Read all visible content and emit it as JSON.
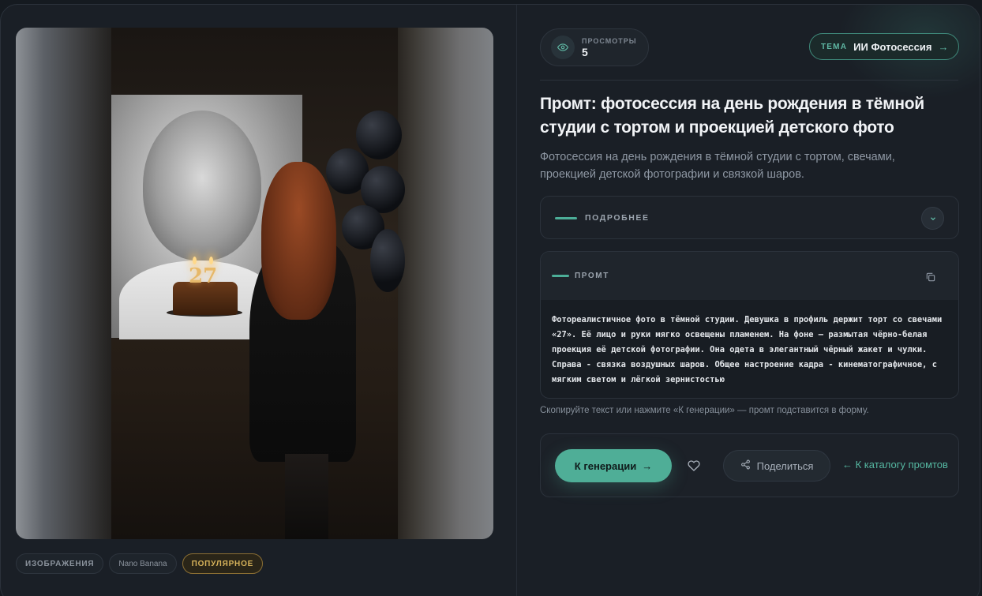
{
  "tags": {
    "category": "ИЗОБРАЖЕНИЯ",
    "model": "Nano Banana",
    "popular": "ПОПУЛЯРНОЕ"
  },
  "views": {
    "label": "ПРОСМОТРЫ",
    "count": "5",
    "icon": "eye-icon"
  },
  "theme": {
    "label": "ТЕМА",
    "value": "ИИ Фотосессия",
    "arrow": "→"
  },
  "title": "Промт: фотосессия на день рождения в тёмной студии с тортом и проекцией детского фото",
  "subtitle": "Фотосессия на день рождения в тёмной студии с тортом, свечами, проекцией детской фотографии и связкой шаров.",
  "details": {
    "label": "ПОДРОБНЕЕ",
    "icon": "chevron-down-icon"
  },
  "prompt": {
    "label": "ПРОМТ",
    "copy_icon": "copy-icon",
    "text": "Фотореалистичное фото в тёмной студии. Девушка в профиль держит торт со свечами «27». Её лицо и руки мягко освещены пламенем. На фоне — размытая чёрно-белая проекция её детской фотографии. Она одета в элегантный чёрный жакет и чулки. Справа - связка воздушных шаров. Общее настроение кадра - кинематографичное, с мягким светом и лёгкой зернистостью"
  },
  "hint": "Скопируйте текст или нажмите «К генерации» — промт подставится в форму.",
  "actions": {
    "generate": "К генерации",
    "generate_arrow": "→",
    "like_icon": "heart-icon",
    "share": "Поделиться",
    "share_icon": "share-icon",
    "catalog": "← К каталогу промтов"
  },
  "image": {
    "cake_number": "27"
  },
  "colors": {
    "accent": "#4fae97",
    "popular": "#d6b25a",
    "background": "#1a1f26"
  }
}
